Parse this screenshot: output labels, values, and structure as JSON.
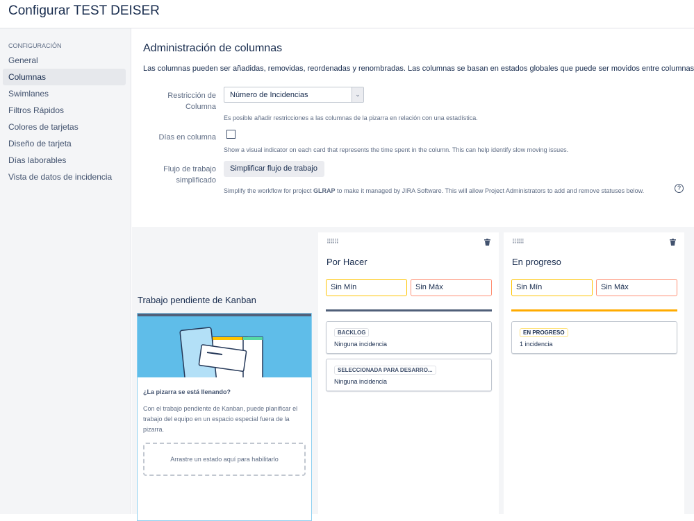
{
  "header": {
    "title": "Configurar TEST DEISER"
  },
  "sidebar": {
    "caption": "CONFIGURACIÓN",
    "items": [
      {
        "label": "General"
      },
      {
        "label": "Columnas"
      },
      {
        "label": "Swimlanes"
      },
      {
        "label": "Filtros Rápidos"
      },
      {
        "label": "Colores de tarjetas"
      },
      {
        "label": "Diseño de tarjeta"
      },
      {
        "label": "Días laborables"
      },
      {
        "label": "Vista de datos de incidencia"
      }
    ]
  },
  "settings": {
    "title": "Administración de columnas",
    "intro": "Las columnas pueden ser añadidas, removidas, reordenadas y renombradas. Las columnas se basan en estados globales que puede ser movidos entre columnas.",
    "restriction_label": "Restricción de Columna",
    "restriction_value": "Número de Incidencias",
    "restriction_help": "Es posible añadir restricciones a las columnas de la pizarra en relación con una estadística.",
    "days_label": "Días en columna",
    "days_help": "Show a visual indicator on each card that represents the time spent in the column. This can help identify slow moving issues.",
    "workflow_label": "Flujo de trabajo simplificado",
    "workflow_button": "Simplificar flujo de trabajo",
    "workflow_help_pre": "Simplify the workflow for project ",
    "workflow_help_project": "GLRAP",
    "workflow_help_post": " to make it managed by JIRA Software. This will allow Project Administrators to add and remove statuses below.",
    "help_icon": "?"
  },
  "backlog": {
    "title": "Trabajo pendiente de Kanban",
    "question": "¿La pizarra se está llenando?",
    "text": "Con el trabajo pendiente de Kanban, puede planificar el trabajo del equipo en un espacio especial fuera de la pizarra.",
    "drop": "Arrastre un estado aquí para habilitarlo"
  },
  "columns": [
    {
      "name": "Por Hacer",
      "min": "Sin Mín",
      "max": "Sin Máx",
      "color": "#505f79",
      "statuses": [
        {
          "name": "BACKLOG",
          "count": "Ninguna incidencia"
        },
        {
          "name": "SELECCIONADA PARA DESARRO...",
          "count": "Ninguna incidencia"
        }
      ]
    },
    {
      "name": "En progreso",
      "min": "Sin Mín",
      "max": "Sin Máx",
      "color": "#ffab00",
      "statuses": [
        {
          "name": "EN PROGRESO",
          "count": "1 incidencia"
        }
      ]
    }
  ]
}
